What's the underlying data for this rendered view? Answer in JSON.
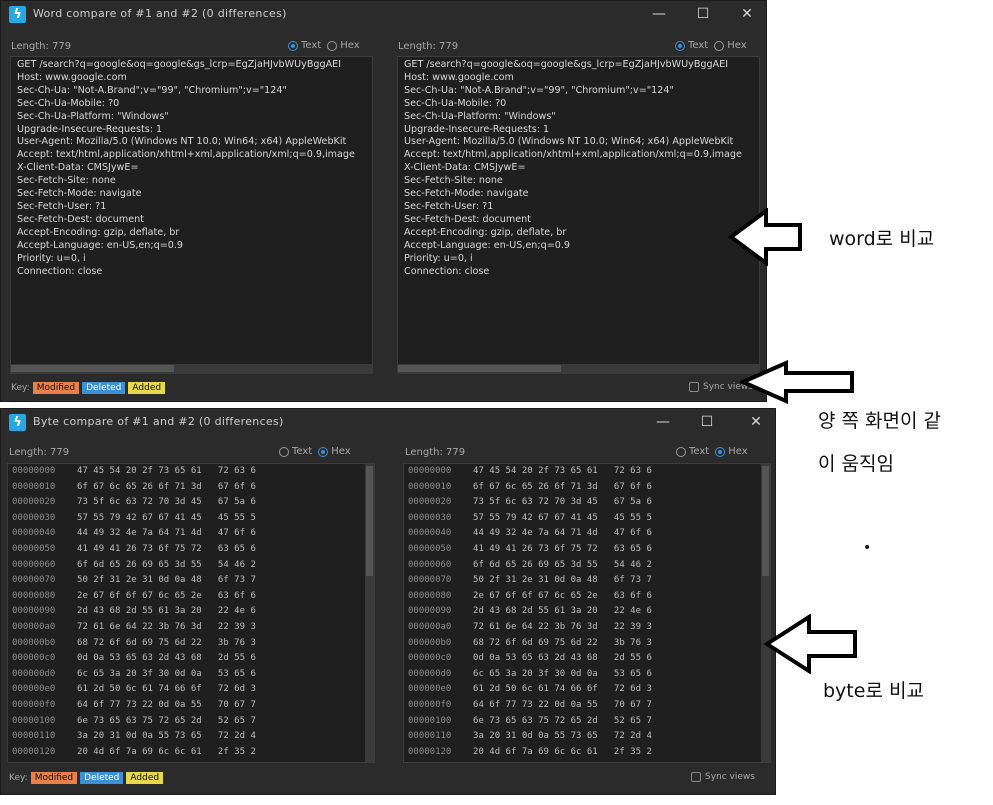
{
  "word_window": {
    "title": "Word compare of #1 and #2  (0 differences)",
    "controls": {
      "minimize": "—",
      "maximize": "☐",
      "close": "✕"
    },
    "left": {
      "length_label": "Length: 779",
      "radio_text": "Text",
      "radio_hex": "Hex"
    },
    "right": {
      "length_label": "Length: 779",
      "radio_text": "Text",
      "radio_hex": "Hex"
    },
    "lines": [
      "GET /search?q=google&oq=google&gs_lcrp=EgZjaHJvbWUyBggAEI",
      "Host: www.google.com",
      "Sec-Ch-Ua: \"Not-A.Brand\";v=\"99\", \"Chromium\";v=\"124\"",
      "Sec-Ch-Ua-Mobile: ?0",
      "Sec-Ch-Ua-Platform: \"Windows\"",
      "Upgrade-Insecure-Requests: 1",
      "User-Agent: Mozilla/5.0 (Windows NT 10.0; Win64; x64) AppleWebKit",
      "Accept: text/html,application/xhtml+xml,application/xml;q=0.9,image",
      "X-Client-Data: CMSJywE=",
      "Sec-Fetch-Site: none",
      "Sec-Fetch-Mode: navigate",
      "Sec-Fetch-User: ?1",
      "Sec-Fetch-Dest: document",
      "Accept-Encoding: gzip, deflate, br",
      "Accept-Language: en-US,en;q=0.9",
      "Priority: u=0, i",
      "Connection: close"
    ],
    "key_label": "Key:",
    "key_modified": "Modified",
    "key_deleted": "Deleted",
    "key_added": "Added",
    "sync_views": "Sync views"
  },
  "byte_window": {
    "title": "Byte compare of #1 and #2  (0 differences)",
    "controls": {
      "minimize": "—",
      "maximize": "☐",
      "close": "✕"
    },
    "left": {
      "length_label": "Length: 779",
      "radio_text": "Text",
      "radio_hex": "Hex"
    },
    "right": {
      "length_label": "Length: 779",
      "radio_text": "Text",
      "radio_hex": "Hex"
    },
    "rows": [
      {
        "offset": "00000000",
        "bytes": "47 45 54 20 2f 73 65 61   72 63 6"
      },
      {
        "offset": "00000010",
        "bytes": "6f 67 6c 65 26 6f 71 3d   67 6f 6"
      },
      {
        "offset": "00000020",
        "bytes": "73 5f 6c 63 72 70 3d 45   67 5a 6"
      },
      {
        "offset": "00000030",
        "bytes": "57 55 79 42 67 67 41 45   45 55 5"
      },
      {
        "offset": "00000040",
        "bytes": "44 49 32 4e 7a 64 71 4d   47 6f 6"
      },
      {
        "offset": "00000050",
        "bytes": "41 49 41 26 73 6f 75 72   63 65 6"
      },
      {
        "offset": "00000060",
        "bytes": "6f 6d 65 26 69 65 3d 55   54 46 2"
      },
      {
        "offset": "00000070",
        "bytes": "50 2f 31 2e 31 0d 0a 48   6f 73 7"
      },
      {
        "offset": "00000080",
        "bytes": "2e 67 6f 6f 67 6c 65 2e   63 6f 6"
      },
      {
        "offset": "00000090",
        "bytes": "2d 43 68 2d 55 61 3a 20   22 4e 6"
      },
      {
        "offset": "000000a0",
        "bytes": "72 61 6e 64 22 3b 76 3d   22 39 3"
      },
      {
        "offset": "000000b0",
        "bytes": "68 72 6f 6d 69 75 6d 22   3b 76 3"
      },
      {
        "offset": "000000c0",
        "bytes": "0d 0a 53 65 63 2d 43 68   2d 55 6"
      },
      {
        "offset": "000000d0",
        "bytes": "6c 65 3a 20 3f 30 0d 0a   53 65 6"
      },
      {
        "offset": "000000e0",
        "bytes": "61 2d 50 6c 61 74 66 6f   72 6d 3"
      },
      {
        "offset": "000000f0",
        "bytes": "64 6f 77 73 22 0d 0a 55   70 67 7"
      },
      {
        "offset": "00000100",
        "bytes": "6e 73 65 63 75 72 65 2d   52 65 7"
      },
      {
        "offset": "00000110",
        "bytes": "3a 20 31 0d 0a 55 73 65   72 2d 4"
      },
      {
        "offset": "00000120",
        "bytes": "20 4d 6f 7a 69 6c 6c 61   2f 35 2"
      }
    ],
    "key_label": "Key:",
    "key_modified": "Modified",
    "key_deleted": "Deleted",
    "key_added": "Added",
    "sync_views": "Sync views"
  },
  "annotations": {
    "word_note": "word로 비교",
    "sync_note_line1": "양 쪽 화면이 같",
    "sync_note_line2": "이 움직임",
    "dot": "•",
    "byte_note": "byte로 비교"
  },
  "colors": {
    "modified": "#e8804a",
    "deleted": "#3d8fd6",
    "added": "#e6d84a",
    "window_bg": "#2b2b2b"
  }
}
